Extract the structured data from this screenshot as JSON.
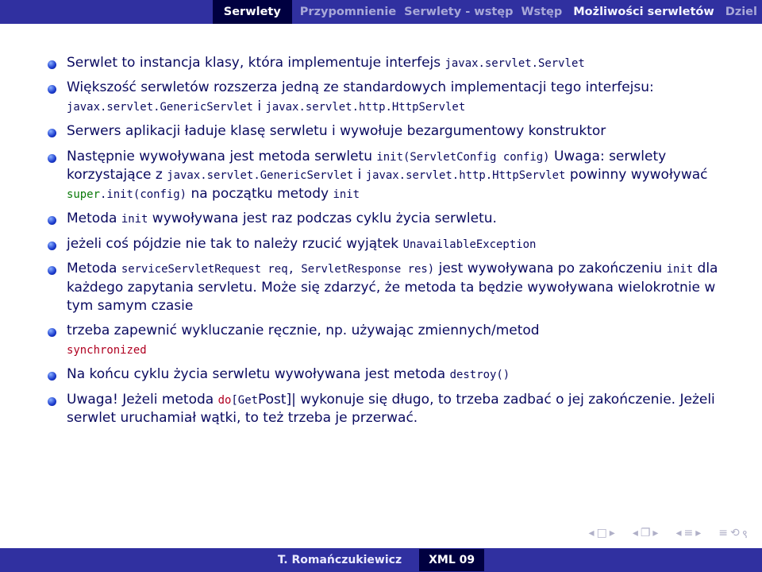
{
  "header": {
    "section": "Serwlety",
    "tabs": [
      "Przypomnienie",
      "Serwlety - wstęp",
      "Wstęp",
      "Możliwości serwletów",
      "Dziel"
    ]
  },
  "bullets": {
    "b1a": "Serwlet to instancja klasy, która implementuje interfejs ",
    "b1_code": "javax.servlet.Servlet",
    "b2a": "Większość serwletów rozszerza jedną ze standardowych implementacji tego interfejsu:",
    "b2_code1": "javax.servlet.GenericServlet",
    "b2_mid": " i ",
    "b2_code2": "javax.servlet.http.HttpServlet",
    "b3": "Serwers aplikacji ładuje klasę serwletu i wywołuje bezargumentowy konstruktor",
    "b4a": "Następnie wywoływana jest metoda serwletu ",
    "b4_code1": "init(ServletConfig config)",
    "b4b": " Uwaga: serwlety korzystające z ",
    "b4_code2": "javax.servlet.GenericServlet",
    "b4c": " i ",
    "b4_code3": "javax.servlet.http.HttpServlet",
    "b4d": " powinny wywoływać ",
    "b4_super": "super",
    "b4_code4": ".init(config)",
    "b4e": " na początku metody ",
    "b4_code5": "init",
    "b5a": "Metoda ",
    "b5_code1": "init",
    "b5b": " wywoływana jest raz podczas cyklu życia serwletu.",
    "b6a": "jeżeli coś pójdzie nie tak to należy rzucić wyjątek ",
    "b6_code": "UnavailableException",
    "b7a": "Metoda ",
    "b7_code1": "serviceServletRequest req, ServletResponse res)",
    "b7b": " jest wywoływana po zakończeniu ",
    "b7_code2": "init",
    "b7c": " dla każdego zapytania servletu. Może się zdarzyć, że metoda ta będzie wywoływana wielokrotnie w tym samym czasie",
    "b8a": "trzeba zapewnić wykluczanie ręcznie, np. używając zmiennych/metod ",
    "b8_kw": "synchronized",
    "b9a": "Na końcu cyklu życia serwletu wywoływana jest metoda ",
    "b9_code": "destroy()",
    "b10a": "Uwaga! Jeżeli metoda ",
    "b10_kw": "do",
    "b10_code": "[Get",
    "b10b": "Post]| wykonuje się długo, to trzeba zadbać o jej zakończenie. Jeżeli serwlet uruchamiał wątki, to też trzeba je przerwać."
  },
  "footer": {
    "author": "T. Romańczukiewicz",
    "course": "XML 09"
  }
}
